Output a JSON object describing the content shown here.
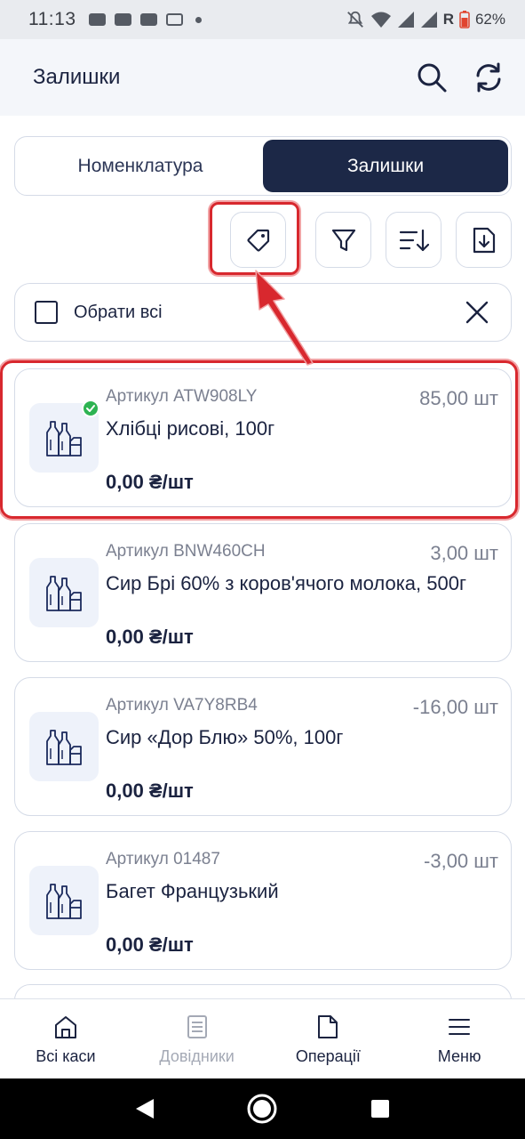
{
  "status_bar": {
    "time": "11:13",
    "network_letter": "R",
    "battery": "62%"
  },
  "header": {
    "title": "Залишки",
    "icons": [
      "search-icon",
      "sync-icon"
    ]
  },
  "tabs": [
    {
      "label": "Номенклатура",
      "active": false
    },
    {
      "label": "Залишки",
      "active": true
    }
  ],
  "toolbar": {
    "icons": [
      "tag-icon",
      "filter-icon",
      "sort-icon",
      "download-icon"
    ]
  },
  "select_all": {
    "label": "Обрати всі"
  },
  "products": [
    {
      "sku": "Артикул ATW908LY",
      "name": "Хлібці рисові, 100г",
      "qty": "85,00 шт",
      "price": "0,00 ₴/шт",
      "selected": true
    },
    {
      "sku": "Артикул BNW460CH",
      "name": "Сир Брі 60% з коров'ячого молока, 500г",
      "qty": "3,00 шт",
      "price": "0,00 ₴/шт",
      "selected": false
    },
    {
      "sku": "Артикул VA7Y8RB4",
      "name": "Сир «Дор Блю» 50%, 100г",
      "qty": "-16,00 шт",
      "price": "0,00 ₴/шт",
      "selected": false
    },
    {
      "sku": "Артикул 01487",
      "name": "Багет Французький",
      "qty": "-3,00 шт",
      "price": "0,00 ₴/шт",
      "selected": false
    }
  ],
  "bottom_nav": [
    {
      "label": "Всі каси",
      "icon": "home-icon",
      "enabled": true
    },
    {
      "label": "Довідники",
      "icon": "directory-icon",
      "enabled": false
    },
    {
      "label": "Операції",
      "icon": "document-icon",
      "enabled": true
    },
    {
      "label": "Меню",
      "icon": "menu-icon",
      "enabled": true
    }
  ],
  "colors": {
    "primary": "#1c2847",
    "annotation": "#d8282e",
    "success": "#2db352"
  }
}
